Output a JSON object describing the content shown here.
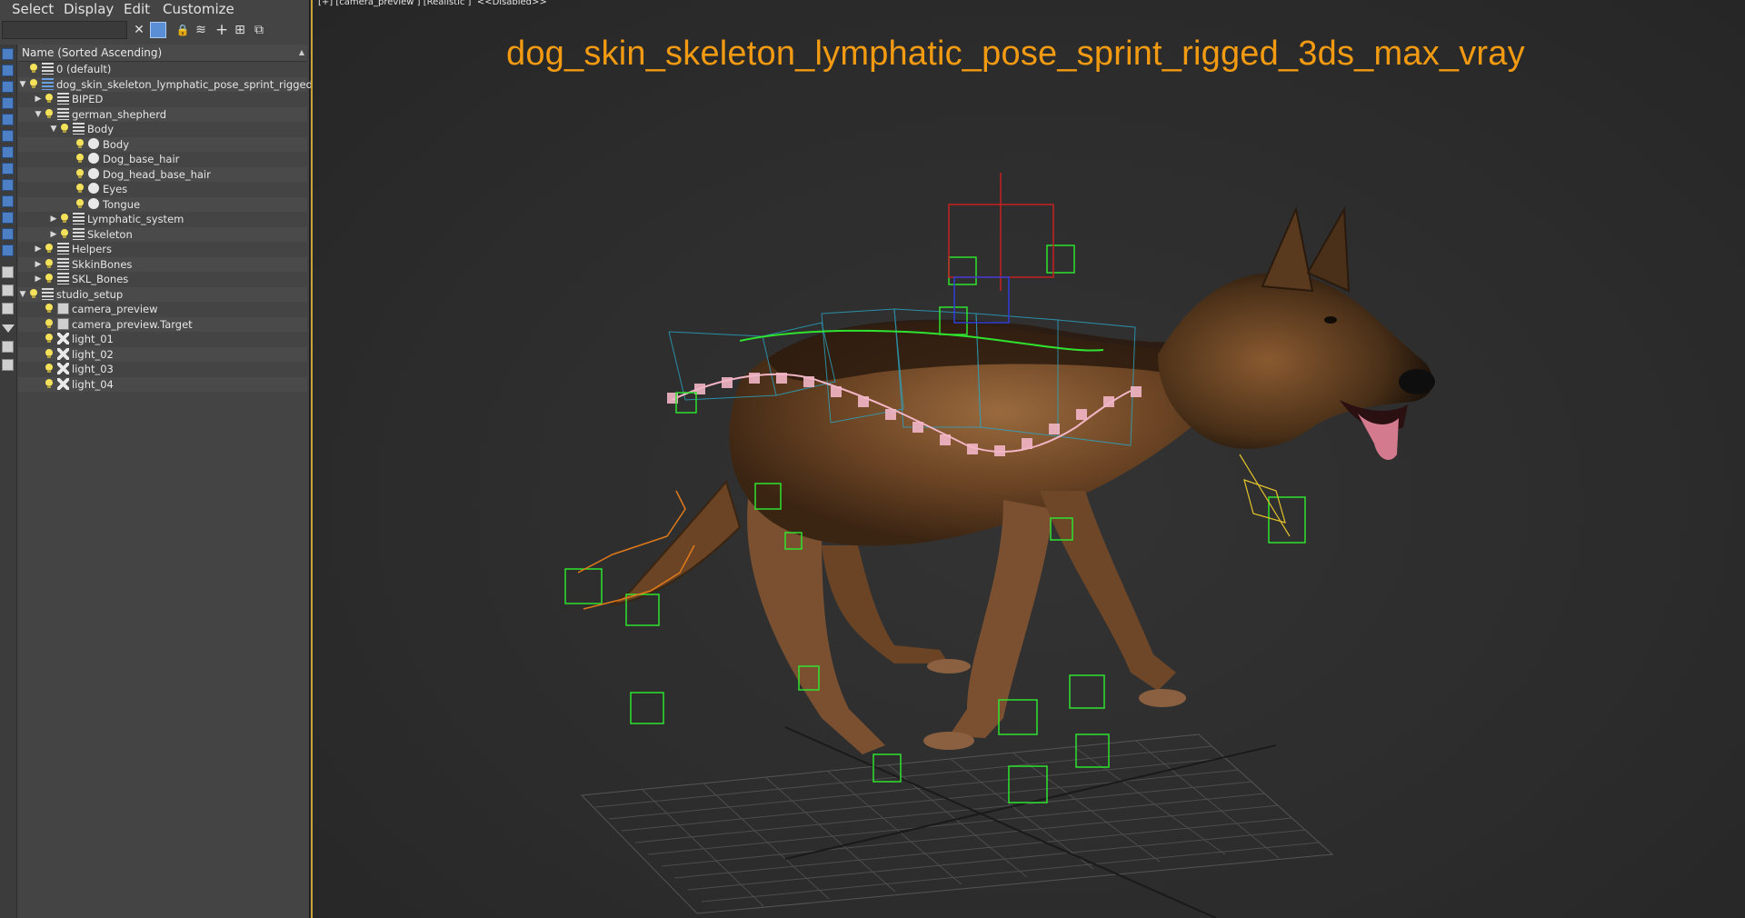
{
  "menu": {
    "select": "Select",
    "display": "Display",
    "edit": "Edit",
    "customize": "Customize"
  },
  "toolbar": {
    "search_value": "",
    "icons": [
      "clear-icon",
      "filter-icon",
      "lock-icon",
      "layer-add-icon",
      "plus-icon",
      "hierarchy-icon",
      "link-icon"
    ]
  },
  "explorer": {
    "column_header": "Name (Sorted Ascending)",
    "rows": [
      {
        "label": "0 (default)",
        "indent": 0,
        "expander": "",
        "icon": "layer"
      },
      {
        "label": "dog_skin_skeleton_lymphatic_pose_sprint_rigged",
        "indent": 0,
        "expander": "▼",
        "icon": "layer-blue"
      },
      {
        "label": "BIPED",
        "indent": 1,
        "expander": "▶",
        "icon": "layer"
      },
      {
        "label": "german_shepherd",
        "indent": 1,
        "expander": "▼",
        "icon": "layer"
      },
      {
        "label": "Body",
        "indent": 2,
        "expander": "▼",
        "icon": "layer"
      },
      {
        "label": "Body",
        "indent": 3,
        "expander": "",
        "icon": "mesh"
      },
      {
        "label": "Dog_base_hair",
        "indent": 3,
        "expander": "",
        "icon": "mesh"
      },
      {
        "label": "Dog_head_base_hair",
        "indent": 3,
        "expander": "",
        "icon": "mesh"
      },
      {
        "label": "Eyes",
        "indent": 3,
        "expander": "",
        "icon": "mesh"
      },
      {
        "label": "Tongue",
        "indent": 3,
        "expander": "",
        "icon": "mesh"
      },
      {
        "label": "Lymphatic_system",
        "indent": 2,
        "expander": "▶",
        "icon": "layer"
      },
      {
        "label": "Skeleton",
        "indent": 2,
        "expander": "▶",
        "icon": "layer"
      },
      {
        "label": "Helpers",
        "indent": 1,
        "expander": "▶",
        "icon": "layer"
      },
      {
        "label": "SkkinBones",
        "indent": 1,
        "expander": "▶",
        "icon": "layer"
      },
      {
        "label": "SKL_Bones",
        "indent": 1,
        "expander": "▶",
        "icon": "layer"
      },
      {
        "label": "studio_setup",
        "indent": 0,
        "expander": "▼",
        "icon": "layer"
      },
      {
        "label": "camera_preview",
        "indent": 1,
        "expander": "",
        "icon": "camera"
      },
      {
        "label": "camera_preview.Target",
        "indent": 1,
        "expander": "",
        "icon": "camera"
      },
      {
        "label": "light_01",
        "indent": 1,
        "expander": "",
        "icon": "light"
      },
      {
        "label": "light_02",
        "indent": 1,
        "expander": "",
        "icon": "light"
      },
      {
        "label": "light_03",
        "indent": 1,
        "expander": "",
        "icon": "light"
      },
      {
        "label": "light_04",
        "indent": 1,
        "expander": "",
        "icon": "light"
      }
    ]
  },
  "viewport": {
    "label_plus": "[+]",
    "label_camera": "[camera_preview ]",
    "label_shading": "[Realistic ]",
    "label_disabled": "<<Disabled>>",
    "title": "dog_skin_skeleton_lymphatic_pose_sprint_rigged_3ds_max_vray",
    "title_color": "#f29b12",
    "border_color": "#c7a33a"
  }
}
